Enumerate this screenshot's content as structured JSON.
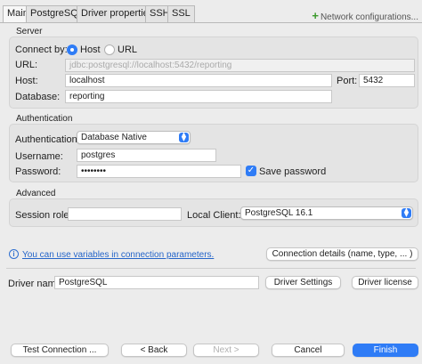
{
  "tabs": [
    {
      "label": "Main",
      "active": true
    },
    {
      "label": "PostgreSQL",
      "active": false
    },
    {
      "label": "Driver properties",
      "active": false
    },
    {
      "label": "SSH",
      "active": false
    },
    {
      "label": "SSL",
      "active": false
    }
  ],
  "network_configurations": {
    "icon": "plus-icon",
    "label": "Network configurations..."
  },
  "server": {
    "section_title": "Server",
    "connect_by_label": "Connect by:",
    "option_host": "Host",
    "option_url": "URL",
    "selected": "Host",
    "url_label": "URL:",
    "url_value": "jdbc:postgresql://localhost:5432/reporting",
    "host_label": "Host:",
    "host_value": "localhost",
    "port_label": "Port:",
    "port_value": "5432",
    "database_label": "Database:",
    "database_value": "reporting"
  },
  "authentication": {
    "section_title": "Authentication",
    "auth_label": "Authentication:",
    "auth_value": "Database Native",
    "username_label": "Username:",
    "username_value": "postgres",
    "password_label": "Password:",
    "password_value": "••••••••",
    "save_password_label": "Save password",
    "save_password_checked": true
  },
  "advanced": {
    "section_title": "Advanced",
    "session_role_label": "Session role:",
    "session_role_value": "",
    "local_client_label": "Local Client:",
    "local_client_value": "PostgreSQL 16.1"
  },
  "info": {
    "icon": "info-icon",
    "icon_glyph": "i",
    "link_text": "You can use variables in connection parameters.",
    "details_button": "Connection details (name, type, ... )"
  },
  "driver": {
    "label": "Driver name:",
    "value": "PostgreSQL",
    "settings_button": "Driver Settings",
    "license_button": "Driver license"
  },
  "footer": {
    "test_button": "Test Connection ...",
    "back_button": "< Back",
    "next_button": "Next >",
    "cancel_button": "Cancel",
    "finish_button": "Finish"
  },
  "colors": {
    "accent": "#2f7cf6",
    "link": "#2565c9",
    "network_plus": "#3a9a2a"
  }
}
